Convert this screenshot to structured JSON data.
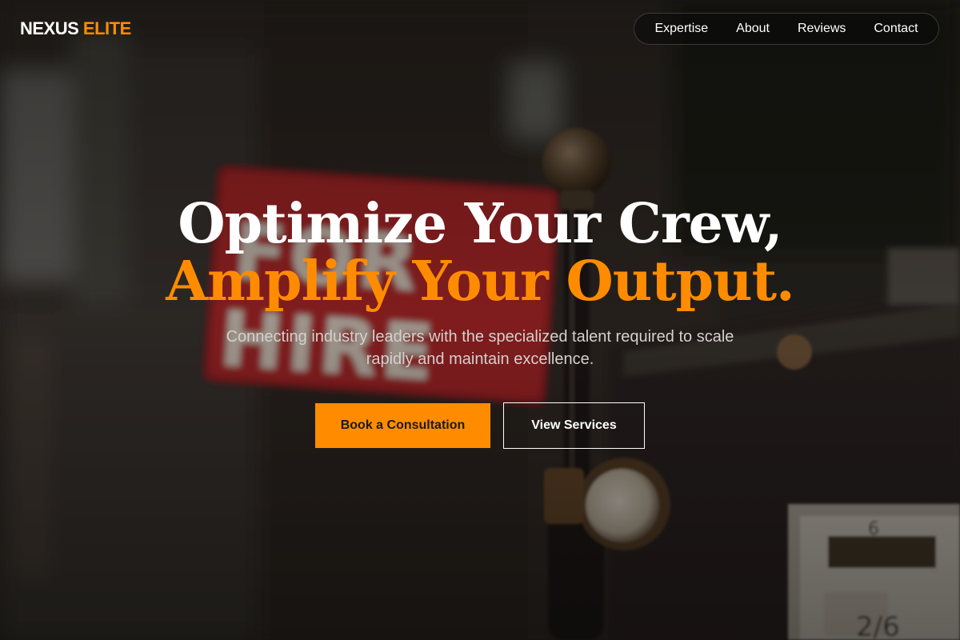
{
  "brand": {
    "name_main": "NEXUS",
    "name_accent": "ELITE",
    "accent_color": "#ff8c00"
  },
  "nav": {
    "items": [
      {
        "label": "Expertise"
      },
      {
        "label": "About"
      },
      {
        "label": "Reviews"
      },
      {
        "label": "Contact"
      }
    ]
  },
  "hero": {
    "headline_line1": "Optimize Your Crew,",
    "headline_line2": "Amplify Your Output.",
    "subtitle": "Connecting industry leaders with the specialized talent required to scale rapidly and maintain excellence.",
    "primary_cta": "Book a Consultation",
    "secondary_cta": "View Services",
    "background_image": "for-hire-sign-photo"
  },
  "colors": {
    "accent": "#ff8c00",
    "text_primary": "#ffffff",
    "text_muted": "#d4d0cc"
  }
}
